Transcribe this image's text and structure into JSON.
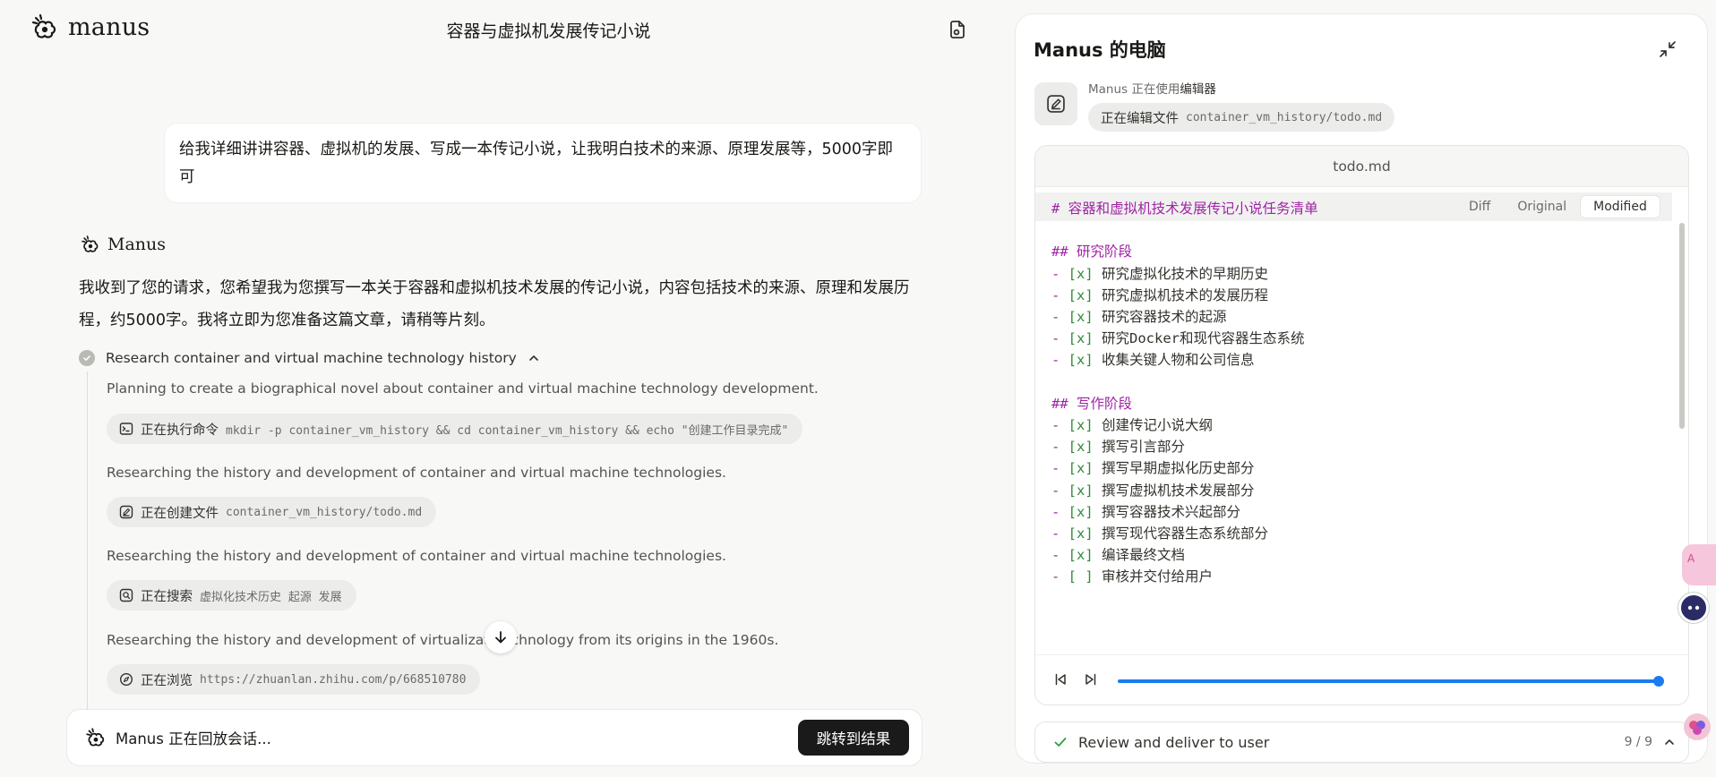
{
  "header": {
    "brand": "manus",
    "title": "容器与虚拟机发展传记小说"
  },
  "user_message": "给我详细讲讲容器、虚拟机的发展、写成一本传记小说，让我明白技术的来源、原理发展等，5000字即可",
  "agent": {
    "name": "Manus",
    "reply": "我收到了您的请求，您希望我为您撰写一本关于容器和虚拟机技术发展的传记小说，内容包括技术的来源、原理和发展历程，约5000字。我将立即为您准备这篇文章，请稍等片刻。"
  },
  "step": {
    "title": "Research container and virtual machine technology history",
    "items": [
      {
        "desc": "Planning to create a biographical novel about container and virtual machine technology development.",
        "icon": "terminal-icon",
        "verb": "正在执行命令",
        "arg": "mkdir -p container_vm_history && cd container_vm_history && echo \"创建工作目录完成\""
      },
      {
        "desc": "Researching the history and development of container and virtual machine technologies.",
        "icon": "edit-icon",
        "verb": "正在创建文件",
        "arg": "container_vm_history/todo.md"
      },
      {
        "desc": "Researching the history and development of container and virtual machine technologies.",
        "icon": "search-icon",
        "verb": "正在搜索",
        "arg": "虚拟化技术历史 起源 发展"
      },
      {
        "desc_left": "Researching the history and development of virtualizati",
        "desc_right": "chnology from its origins in the 1960s.",
        "icon": "compass-icon",
        "verb": "正在浏览",
        "arg": "https://zhuanlan.zhihu.com/p/668510780"
      }
    ]
  },
  "replay": {
    "text": "Manus 正在回放会话...",
    "button": "跳转到结果"
  },
  "computer": {
    "title": "Manus 的电脑",
    "status_prefix": "Manus 正在使用",
    "status_tool": "编辑器",
    "chip_verb": "正在编辑文件",
    "chip_arg": "container_vm_history/todo.md",
    "file_tab": "todo.md",
    "view_modes": [
      "Diff",
      "Original",
      "Modified"
    ],
    "active_mode": "Modified",
    "code": {
      "title": "# 容器和虚拟机技术发展传记小说任务清单",
      "sections": [
        {
          "heading": "## 研究阶段",
          "items": [
            {
              "mark": "[x]",
              "text": "研究虚拟化技术的早期历史"
            },
            {
              "mark": "[x]",
              "text": "研究虚拟机技术的发展历程"
            },
            {
              "mark": "[x]",
              "text": "研究容器技术的起源"
            },
            {
              "mark": "[x]",
              "text": "研究Docker和现代容器生态系统"
            },
            {
              "mark": "[x]",
              "text": "收集关键人物和公司信息"
            }
          ]
        },
        {
          "heading": "## 写作阶段",
          "items": [
            {
              "mark": "[x]",
              "text": "创建传记小说大纲"
            },
            {
              "mark": "[x]",
              "text": "撰写引言部分"
            },
            {
              "mark": "[x]",
              "text": "撰写早期虚拟化历史部分"
            },
            {
              "mark": "[x]",
              "text": "撰写虚拟机技术发展部分"
            },
            {
              "mark": "[x]",
              "text": "撰写容器技术兴起部分"
            },
            {
              "mark": "[x]",
              "text": "撰写现代容器生态系统部分"
            },
            {
              "mark": "[x]",
              "text": "编译最终文档"
            },
            {
              "mark": "[ ]",
              "text": "审核并交付给用户"
            }
          ]
        }
      ]
    },
    "playback_progress": 1.0,
    "task": {
      "text": "Review and deliver to user",
      "count": "9 / 9"
    }
  },
  "colors": {
    "accent": "#1a7cf0",
    "heading": "#a024a6",
    "checkbox": "#2f8a36",
    "success": "#2e9e45"
  }
}
